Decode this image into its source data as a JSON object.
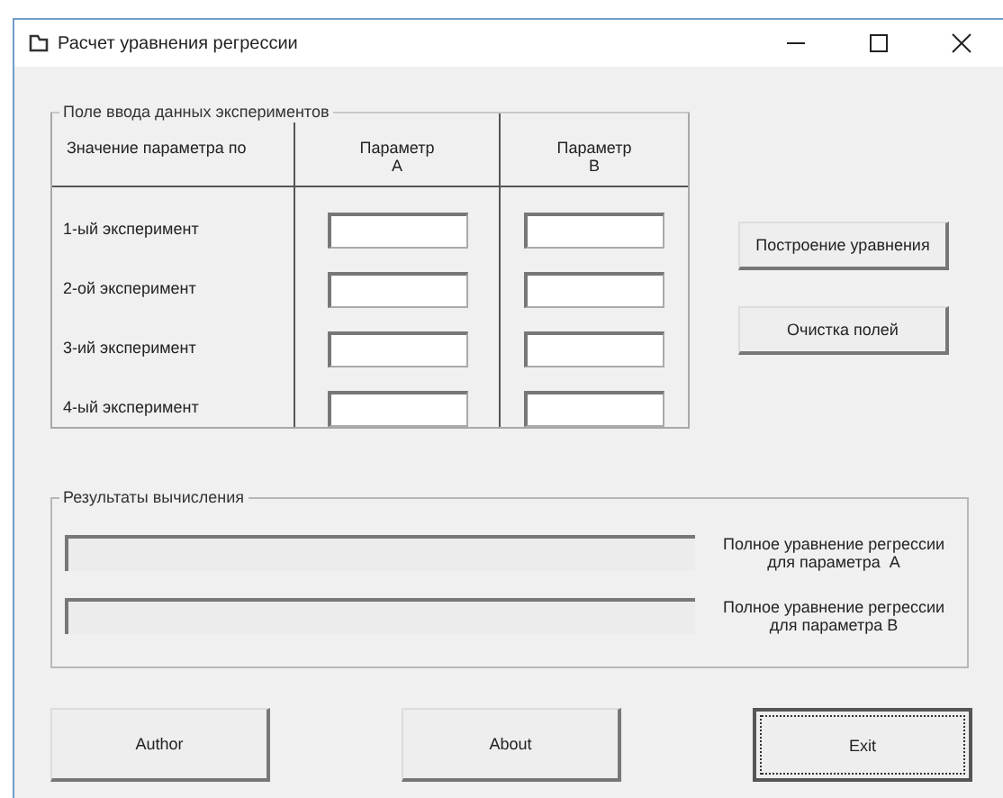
{
  "window": {
    "title": "Расчет уравнения регрессии"
  },
  "input_group": {
    "legend": "Поле ввода данных экспериментов",
    "columns": [
      "Значение параметра по",
      "Параметр\nA",
      "Параметр\nB"
    ],
    "rows": [
      {
        "label": "1-ый эксперимент"
      },
      {
        "label": "2-ой эксперимент"
      },
      {
        "label": "3-ий эксперимент"
      },
      {
        "label": "4-ый эксперимент"
      }
    ]
  },
  "side_buttons": [
    "Построение уравнения",
    "Очистка полей"
  ],
  "results_group": {
    "legend": "Результаты вычисления",
    "rows": [
      {
        "label": "Полное уравнение регрессии\nдля параметра  A"
      },
      {
        "label": "Полное уравнение регрессии\nдля параметра B"
      }
    ]
  },
  "bottom_buttons": [
    {
      "label": "Author",
      "focused": false
    },
    {
      "label": "About",
      "focused": false
    },
    {
      "label": "Exit",
      "focused": true
    }
  ]
}
